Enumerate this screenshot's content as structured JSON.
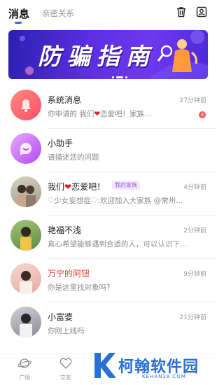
{
  "tabs": {
    "active": "消息",
    "inactive": "亲密关系"
  },
  "banner": {
    "title": "防骗指南"
  },
  "conversations": [
    {
      "name": "系统消息",
      "preview_pre": "你申请的 我们",
      "preview_post": "恋爱吧！家族...",
      "time": "27分钟前",
      "badge": "3"
    },
    {
      "name": "小助手",
      "preview": "请描述您的问题"
    },
    {
      "name_pre": "我们",
      "name_post": "恋爱吧！",
      "tag": "我的家族",
      "preview": "♡少女妄想症♡:欢迎加入大家族 @常州...",
      "time": "4分钟前"
    },
    {
      "name": "艳福不浅",
      "preview": "真心希望能够遇到合适的人，可以认识下...",
      "time": "2分钟前"
    },
    {
      "name": "万宁的阿钮",
      "preview": "你是这里找对象吗?",
      "time": "9分钟前"
    },
    {
      "name": "小富婆",
      "preview": "你刚上线吗",
      "time": "21分钟前"
    }
  ],
  "heart_glyph": "❤",
  "bottom_nav": [
    {
      "label": "广场"
    },
    {
      "label": "交友"
    }
  ],
  "watermark": {
    "text": "柯翰软件园",
    "sub": "KEHAN38.COM"
  },
  "colors": {
    "accent": "#2d6bff",
    "badge": "#f05a5a",
    "highlight_name": "#e0413a"
  },
  "icons": [
    "trash-icon",
    "contact-card-icon",
    "bell-icon",
    "assistant-chat-icon",
    "square-planet-icon",
    "friends-heart-icon"
  ]
}
